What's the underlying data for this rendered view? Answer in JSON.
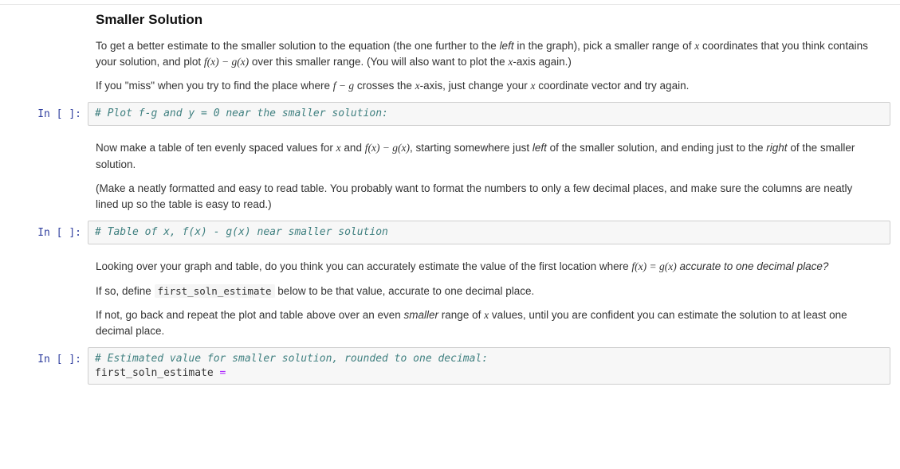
{
  "heading": "Smaller Solution",
  "md1": {
    "p1a": "To get a better estimate to the smaller solution to the equation (the one further to the ",
    "p1em": "left",
    "p1b": " in the graph), pick a smaller range of ",
    "p1c": " coordinates that you think contains your solution, and plot ",
    "p1d": " over this smaller range. (You will also want to plot the ",
    "p1e": "-axis again.)",
    "p2a": "If you \"miss\" when you try to find the place where ",
    "p2b": " crosses the ",
    "p2c": "-axis, just change your ",
    "p2d": " coordinate vector and try again."
  },
  "math": {
    "x": "x",
    "f": "f",
    "g": "g",
    "paren_x": "(x)",
    "minus": " − ",
    "eq": " = ",
    "fx_minus_gx": "f(x) − g(x)",
    "f_minus_g": "f − g",
    "fx_eq_gx": "f(x) = g(x)"
  },
  "prompts": {
    "in_empty": "In [ ]:"
  },
  "code1": {
    "comment": "# Plot f-g and y = 0 near the smaller solution:"
  },
  "md2": {
    "p1a": "Now make a table of ten evenly spaced values for ",
    "p1b": " and ",
    "p1c": ", starting somewhere just ",
    "p1em1": "left",
    "p1d": " of the smaller solution, and ending just to the ",
    "p1em2": "right",
    "p1e": " of the smaller solution.",
    "p2": "(Make a neatly formatted and easy to read table. You probably want to format the numbers to only a few decimal places, and make sure the columns are neatly lined up so the table is easy to read.)"
  },
  "code2": {
    "comment": "# Table of x, f(x) - g(x) near smaller solution"
  },
  "md3": {
    "p1a": "Looking over your graph and table, do you think you can accurately estimate the value of the first location where ",
    "p1b": " ",
    "p1em": "accurate to one decimal place?",
    "p2a": "If so, define ",
    "p2code": "first_soln_estimate",
    "p2b": " below to be that value, accurate to one decimal place.",
    "p3a": "If not, go back and repeat the plot and table above over an even ",
    "p3em": "smaller",
    "p3b": " range of ",
    "p3c": " values, until you are confident you can estimate the solution to at least one decimal place."
  },
  "code3": {
    "comment": "# Estimated value for smaller solution, rounded to one decimal:",
    "ident": "first_soln_estimate ",
    "op": "="
  }
}
